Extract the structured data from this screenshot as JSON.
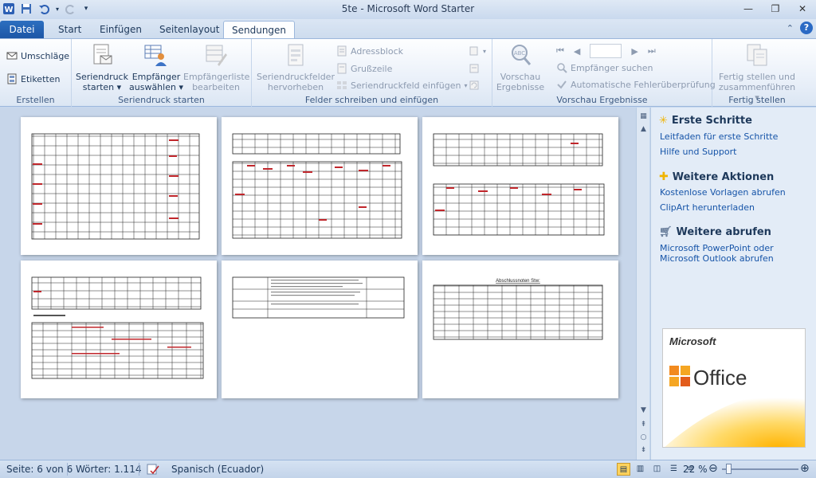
{
  "window": {
    "title": "5te - Microsoft Word Starter"
  },
  "tabs": [
    {
      "label": "Datei"
    },
    {
      "label": "Start"
    },
    {
      "label": "Einfügen"
    },
    {
      "label": "Seitenlayout"
    },
    {
      "label": "Sendungen"
    }
  ],
  "ribbon": {
    "erstellen": {
      "label": "Erstellen",
      "umschlaege": "Umschläge",
      "etiketten": "Etiketten"
    },
    "seriendruck_starten": {
      "label": "Seriendruck starten",
      "starten_line1": "Seriendruck",
      "starten_line2": "starten",
      "empfaenger_line1": "Empfänger",
      "empfaenger_line2": "auswählen",
      "liste_line1": "Empfängerliste",
      "liste_line2": "bearbeiten"
    },
    "felder": {
      "label": "Felder schreiben und einfügen",
      "hervorheben_line1": "Seriendruckfelder",
      "hervorheben_line2": "hervorheben",
      "adressblock": "Adressblock",
      "grusszeile": "Grußzeile",
      "feld_einfuegen": "Seriendruckfeld einfügen"
    },
    "vorschau": {
      "label": "Vorschau Ergebnisse",
      "vorschau_line1": "Vorschau",
      "vorschau_line2": "Ergebnisse",
      "empfaenger_suchen": "Empfänger suchen",
      "fehlerpruefung": "Automatische Fehlerüberprüfung"
    },
    "fertig": {
      "label": "Fertig stellen",
      "btn_line1": "Fertig stellen und",
      "btn_line2": "zusammenführen"
    }
  },
  "pages": [
    {
      "kind": "table-grid"
    },
    {
      "kind": "table-two"
    },
    {
      "kind": "table-two"
    },
    {
      "kind": "table-text"
    },
    {
      "kind": "text-table"
    },
    {
      "kind": "summary",
      "heading": "Abschlussnoten Stw:"
    }
  ],
  "pane": {
    "erste_schritte": "Erste Schritte",
    "leitfaden": "Leitfaden für erste Schritte",
    "hilfe": "Hilfe und Support",
    "weitere_aktionen": "Weitere Aktionen",
    "vorlagen": "Kostenlose Vorlagen abrufen",
    "clipart": "ClipArt herunterladen",
    "weitere_abrufen": "Weitere abrufen",
    "powerpoint": "Microsoft PowerPoint oder Microsoft Outlook abrufen",
    "ad_microsoft": "Microsoft",
    "ad_office": "Office"
  },
  "status": {
    "seite": "Seite: 6 von 6",
    "woerter": "Wörter: 1.114",
    "sprache": "Spanisch (Ecuador)",
    "zoom": "22 %"
  },
  "colors": {
    "file_tab": "#1c56a6",
    "link": "#1654a8",
    "ribbon_text": "#1e395b"
  }
}
